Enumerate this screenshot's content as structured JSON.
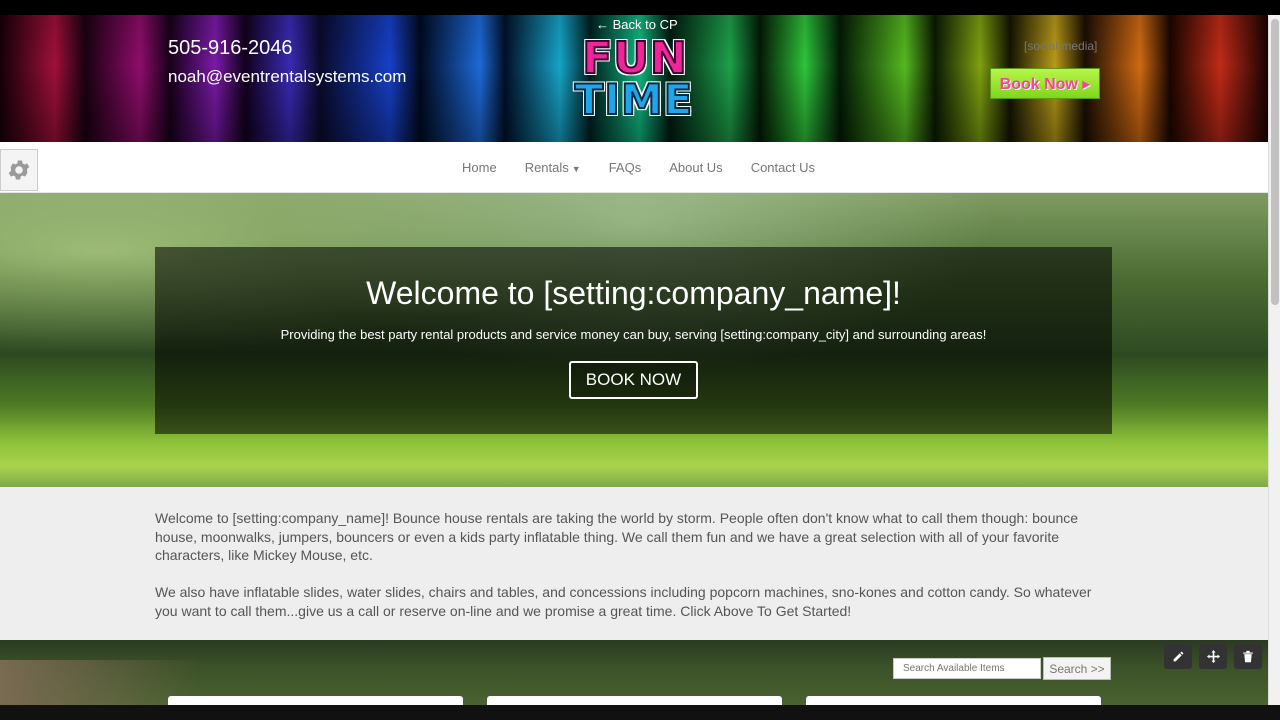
{
  "header": {
    "phone": "505-916-2046",
    "email": "noah@eventrentalsystems.com",
    "back_link": "← Back to CP",
    "logo_line1": "FUN",
    "logo_line2": "TIME",
    "social": "[social media]",
    "book_now": "Book Now ▸"
  },
  "nav": {
    "items": [
      {
        "label": "Home"
      },
      {
        "label": "Rentals"
      },
      {
        "label": "FAQs"
      },
      {
        "label": "About Us"
      },
      {
        "label": "Contact Us"
      }
    ]
  },
  "hero": {
    "title": "Welcome to [setting:company_name]!",
    "subtitle": "Providing the best party rental products and service money can buy, serving [setting:company_city] and surrounding areas!",
    "button": "BOOK NOW"
  },
  "intro": {
    "paragraph1": "Welcome to [setting:company_name]! Bounce house rentals are taking the world by storm. People often don't know what to call them though: bounce house, moonwalks, jumpers, bouncers or even a kids party inflatable thing. We call them fun and we have a great selection with all of your favorite characters, like Mickey Mouse, etc.",
    "paragraph2": "We also have inflatable slides, water slides, chairs and tables, and concessions including popcorn machines, sno-kones and cotton candy. So whatever you want to call them...give us a call or reserve on-line and we promise a great time. Click Above To Get Started!"
  },
  "search": {
    "placeholder": "Search Available Items",
    "button": "Search >>"
  },
  "icons": {
    "settings": "gear-icon",
    "edit": "pencil-icon",
    "move": "move-icon",
    "delete": "trash-icon"
  },
  "colors": {
    "book_now_bg": "#8fe02a",
    "book_now_text": "#ff3fa0",
    "logo_pink": "#f0259a",
    "logo_blue": "#1fa6e8",
    "intro_bg": "#eeeeee"
  }
}
